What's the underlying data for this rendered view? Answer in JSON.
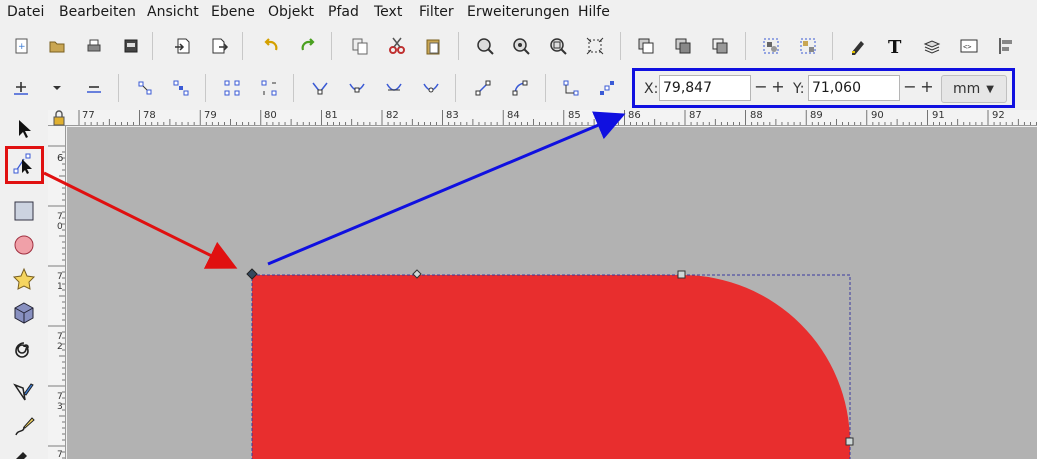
{
  "menu": [
    "Datei",
    "Bearbeiten",
    "Ansicht",
    "Ebene",
    "Objekt",
    "Pfad",
    "Text",
    "Filter",
    "Erweiterungen",
    "Hilfe"
  ],
  "coords": {
    "x_label": "X:",
    "x_value": "79,847",
    "y_label": "Y:",
    "y_value": "71,060",
    "unit": "mm",
    "minus": "−",
    "plus": "+"
  },
  "ruler_top_labels": [
    "77",
    "78",
    "79",
    "80",
    "81",
    "82",
    "83",
    "84",
    "85",
    "86",
    "87",
    "88",
    "89",
    "90",
    "91",
    "92"
  ],
  "ruler_left_labels": [
    "6",
    "7 0",
    "7 1",
    "7 2",
    "7 3",
    "7"
  ],
  "shape": {
    "fill": "#e82e2e"
  },
  "colors": {
    "red_highlight": "#e01010",
    "blue_highlight": "#1010e0",
    "canvas": "#b2b2b2"
  },
  "icons": {
    "toolbar1": [
      "new-document-icon",
      "open-icon",
      "print-icon",
      "print-preview-icon",
      "import-icon",
      "export-icon",
      "undo-icon",
      "redo-icon",
      "copy-icon",
      "cut-icon",
      "paste-icon",
      "zoom-selection-icon",
      "zoom-drawing-icon",
      "zoom-page-icon",
      "zoom-fit-icon",
      "duplicate-icon",
      "clone-icon",
      "unlink-clone-icon",
      "group-icon",
      "ungroup-icon",
      "fill-stroke-icon",
      "text-font-icon",
      "layers-icon",
      "xml-editor-icon",
      "align-icon"
    ],
    "toolbar2": [
      "insert-node-icon",
      "dropdown-icon",
      "delete-node-icon",
      "join-nodes-icon",
      "break-path-icon",
      "join-segment-icon",
      "delete-segment-icon",
      "node-cusp-icon",
      "node-smooth-icon",
      "node-symmetric-icon",
      "node-auto-icon",
      "segment-line-icon",
      "segment-curve-icon",
      "object-to-path-icon",
      "stroke-to-path-icon"
    ],
    "toolbox": [
      "selector-tool-icon",
      "node-tool-icon",
      "rectangle-tool-icon",
      "circle-tool-icon",
      "star-tool-icon",
      "3d-box-tool-icon",
      "spiral-tool-icon",
      "pen-tool-icon",
      "pencil-tool-icon",
      "calligraphy-tool-icon"
    ]
  }
}
